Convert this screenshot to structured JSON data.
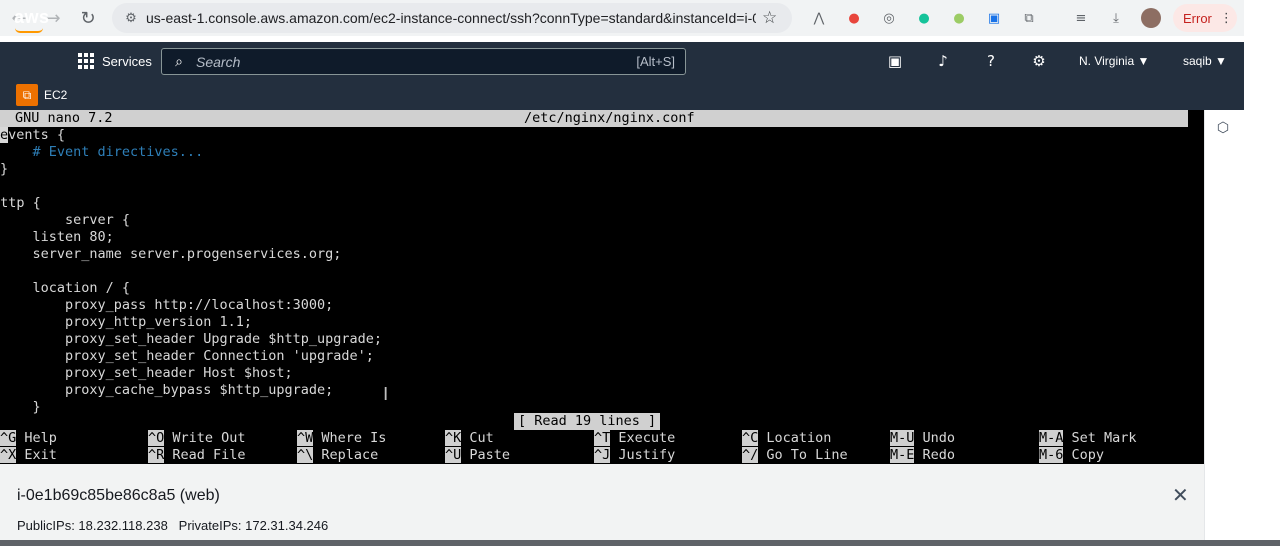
{
  "browser": {
    "url": "us-east-1.console.aws.amazon.com/ec2-instance-connect/ssh?connType=standard&instanceId=i-0...",
    "error_label": "Error"
  },
  "aws_header": {
    "logo": "aws",
    "services_label": "Services",
    "search_placeholder": "Search",
    "search_shortcut": "[Alt+S]",
    "region": "N. Virginia ▼",
    "user": "saqib ▼"
  },
  "service": {
    "name": "EC2"
  },
  "nano": {
    "version": "GNU nano 7.2",
    "filename": "/etc/nginx/nginx.conf",
    "lines": [
      "events {",
      "    # Event directives...",
      "}",
      "",
      "http {",
      "        server {",
      "    listen 80;",
      "    server_name server.progenservices.org;",
      "",
      "    location / {",
      "        proxy_pass http://localhost:3000;",
      "        proxy_http_version 1.1;",
      "        proxy_set_header Upgrade $http_upgrade;",
      "        proxy_set_header Connection 'upgrade';",
      "        proxy_set_header Host $host;",
      "        proxy_cache_bypass $http_upgrade;",
      "    }"
    ],
    "status_message": "[ Read 19 lines ]",
    "shortcuts": [
      {
        "key": "^G",
        "label": "Help"
      },
      {
        "key": "^O",
        "label": "Write Out"
      },
      {
        "key": "^W",
        "label": "Where Is"
      },
      {
        "key": "^K",
        "label": "Cut"
      },
      {
        "key": "^T",
        "label": "Execute"
      },
      {
        "key": "^C",
        "label": "Location"
      },
      {
        "key": "M-U",
        "label": "Undo"
      },
      {
        "key": "M-A",
        "label": "Set Mark"
      },
      {
        "key": "^X",
        "label": "Exit"
      },
      {
        "key": "^R",
        "label": "Read File"
      },
      {
        "key": "^\\",
        "label": "Replace"
      },
      {
        "key": "^U",
        "label": "Paste"
      },
      {
        "key": "^J",
        "label": "Justify"
      },
      {
        "key": "^/",
        "label": "Go To Line"
      },
      {
        "key": "M-E",
        "label": "Redo"
      },
      {
        "key": "M-6",
        "label": "Copy"
      }
    ]
  },
  "instance": {
    "title": "i-0e1b69c85be86c8a5 (web)",
    "ips": "PublicIPs: 18.232.118.238   PrivateIPs: 172.31.34.246"
  }
}
